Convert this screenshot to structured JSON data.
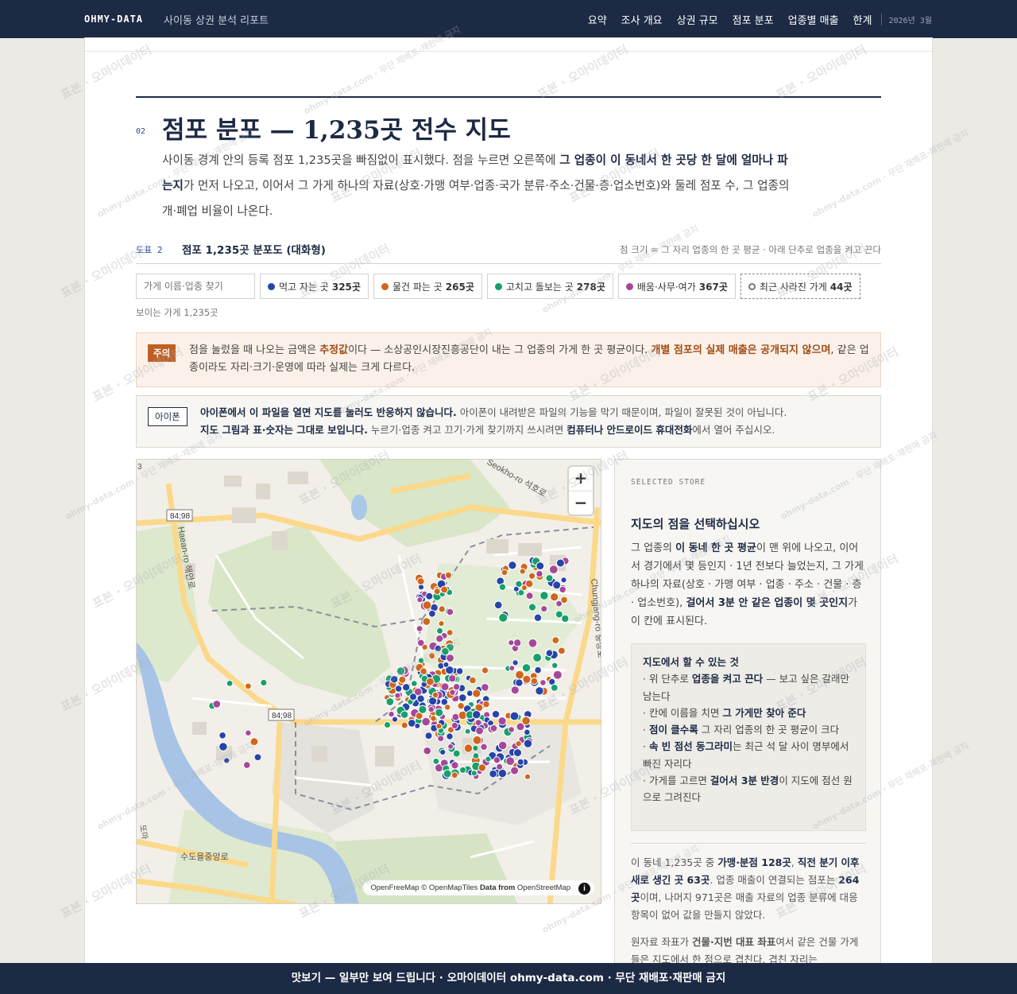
{
  "header": {
    "brand": "OHMY-DATA",
    "report_title": "사이동 상권 분석 리포트",
    "nav": [
      "요약",
      "조사 개요",
      "상권 규모",
      "점포 분포",
      "업종별 매출",
      "한계"
    ],
    "date": "2026년 3월"
  },
  "section": {
    "number": "02",
    "title": "점포 분포 — 1,235곳 전수 지도",
    "lede_1": "사이동 경계 안의 등록 점포 1,235곳을 빠짐없이 표시했다. 점을 누르면 오른쪽에 ",
    "lede_b": "그 업종이 이 동네서 한 곳당 한 달에 얼마나 파는지",
    "lede_2": "가 먼저 나오고, 이어서 그 가게 하나의 자료(상호·가맹 여부·업종·국가 분류·주소·건물·층·업소번호)와 둘레 점포 수, 그 업종의 개·폐업 비율이 나온다."
  },
  "figure": {
    "number": "도표 2",
    "title": "점포 1,235곳 분포도 (대화형)",
    "note": "점 크기 = 그 자리 업종의 한 곳 평균 · 아래 단추로 업종을 켜고 끈다"
  },
  "controls": {
    "search_placeholder": "가게 이름·업종 찾기",
    "filters": [
      {
        "label": "먹고 자는 곳",
        "count": "325곳",
        "color": "#2744a8"
      },
      {
        "label": "물건 파는 곳",
        "count": "265곳",
        "color": "#d0661c"
      },
      {
        "label": "고치고 돌보는 곳",
        "count": "278곳",
        "color": "#16a06a"
      },
      {
        "label": "배움·사무·여가",
        "count": "367곳",
        "color": "#a6479a"
      }
    ],
    "closed_label": "최근 사라진 가게",
    "closed_count": "44곳",
    "visible": "보이는 가게 1,235곳"
  },
  "caution": {
    "tag": "주의",
    "text_1": "점을 눌렀을 때 나오는 금액은 ",
    "b1": "추정값",
    "text_2": "이다 — 소상공인시장진흥공단이 내는 그 업종의 가게 한 곳 평균이다. ",
    "b2": "개별 점포의 실제 매출은 공개되지 않으며",
    "text_3": ", 같은 업종이라도 자리·크기·운영에 따라 실제는 크게 다르다."
  },
  "iphone": {
    "tag": "아이폰",
    "b1": "아이폰에서 이 파일을 열면 지도를 눌러도 반응하지 않습니다.",
    "t1": " 아이폰이 내려받은 파일의 기능을 막기 때문이며, 파일이 잘못된 것이 아닙니다.",
    "b2": "지도 그림과 표·숫자는 그대로 보입니다.",
    "t2": " 누르기·업종 켜고 끄기·가게 찾기까지 쓰시려면 ",
    "b3": "컴퓨터나 안드로이드 휴대전화",
    "t3": "에서 열어 주십시오."
  },
  "map": {
    "zoom_in": "+",
    "zoom_out": "−",
    "attribution_1": "OpenFreeMap © OpenMapTiles ",
    "attribution_b": "Data from",
    "attribution_2": " OpenStreetMap",
    "info": "i",
    "labels": {
      "road1": "84;98",
      "road2": "84;98",
      "road_hae": "Haean-ro 해안로",
      "road_seok": "Seokho-ro 석호로",
      "road_chung": "Chungjang-ro 충장로",
      "place": "수도을중앙로",
      "edge": "3",
      "edge2": "또마"
    }
  },
  "panel": {
    "label": "SELECTED STORE",
    "title": "지도의 점을 선택하십시오",
    "body_1": "그 업종의 ",
    "body_b1": "이 동네 한 곳 평균",
    "body_2": "이 맨 위에 나오고, 이어서 경기에서 몇 등인지 · 1년 전보다 늘었는지, 그 가게 하나의 자료(상호 · 가맹 여부 · 업종 · 주소 · 건물 · 층 · 업소번호), ",
    "body_b2": "걸어서 3분 안 같은 업종이 몇 곳인지",
    "body_3": "가 이 칸에 표시된다.",
    "howto_title": "지도에서 할 수 있는 것",
    "howto": [
      [
        "· 위 단추로 ",
        "업종을 켜고 끈다",
        " — 보고 싶은 갈래만 남는다"
      ],
      [
        "· 칸에 이름을 치면 ",
        "그 가게만 찾아 준다",
        ""
      ],
      [
        "· ",
        "점이 클수록",
        " 그 자리 업종의 한 곳 평균이 크다"
      ],
      [
        "· ",
        "속 빈 점선 동그라미",
        "는 최근 석 달 사이 명부에서 빠진 자리다"
      ],
      [
        "· 가게를 고르면 ",
        "걸어서 3분 반경",
        "이 지도에 점선 원으로 그려진다"
      ]
    ],
    "stats_1": "이 동네 1,235곳 중 ",
    "stats_b1": "가맹·분점 128곳",
    "stats_2": ", ",
    "stats_b2": "직전 분기 이후 새로 생긴 곳 63곳",
    "stats_3": ". 업종 매출이 연결되는 점포는 ",
    "stats_b3": "264곳",
    "stats_4": "이며, 나머지 971곳은 매출 자료의 업종 분류에 대응 항목이 없어 값을 만들지 않았다.",
    "more_1": "원자료 좌표가 ",
    "more_b": "건물·지번 대표 좌표",
    "more_2": "여서 같은 건물 가게들은 지도에서 한 점으로 겹친다. 겹친 자리는"
  },
  "footer": {
    "text": "맛보기 — 일부만 보여 드립니다 · 오마이데이터 ohmy-data.com · 무단 재배포·재판매 금지"
  },
  "watermark": {
    "text": "표본 · 오마이데이터",
    "site": "ohmy-data.com · 무단 재배포·재판매 금지"
  }
}
